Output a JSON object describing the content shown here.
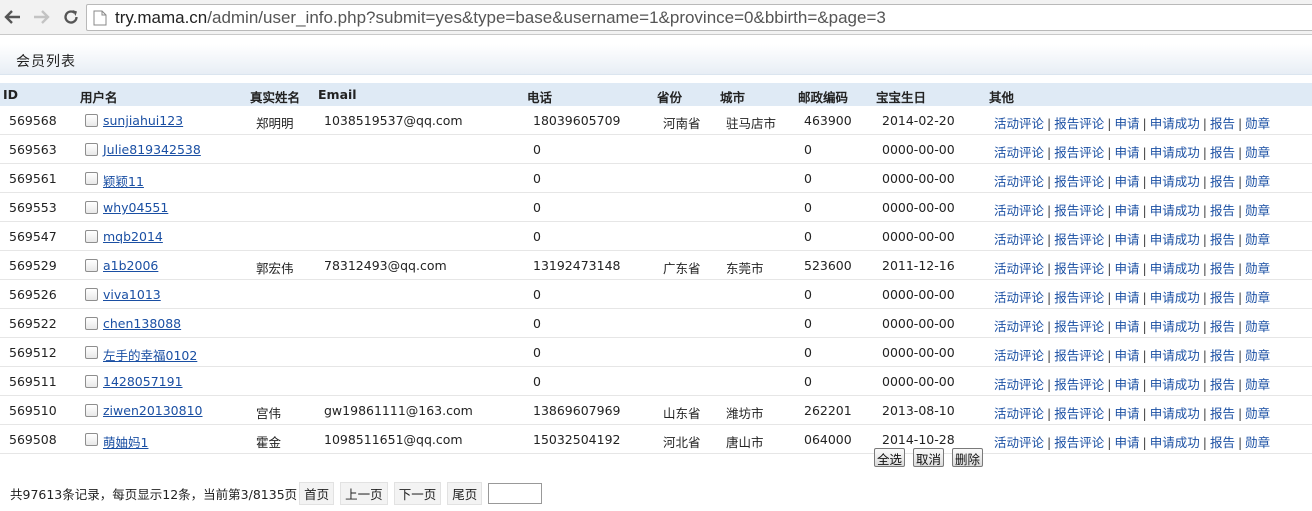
{
  "browser": {
    "url_host": "try.mama.cn",
    "url_path": "/admin/user_info.php?submit=yes&type=base&username=1&province=0&bbirth=&page=3"
  },
  "page": {
    "title": "会员列表"
  },
  "table": {
    "headers": [
      "ID",
      "用户名",
      "真实姓名",
      "Email",
      "电话",
      "省份",
      "城市",
      "邮政编码",
      "宝宝生日",
      "其他"
    ],
    "row_actions": [
      "活动评论",
      "报告评论",
      "申请",
      "申请成功",
      "报告",
      "勋章"
    ],
    "rows": [
      {
        "id": "569568",
        "username": "sunjiahui123",
        "realname": "郑明明",
        "email": "1038519537@qq.com",
        "phone": "18039605709",
        "province": "河南省",
        "city": "驻马店市",
        "zip": "463900",
        "birth": "2014-02-20"
      },
      {
        "id": "569563",
        "username": "Julie819342538",
        "realname": "",
        "email": "",
        "phone": "0",
        "province": "",
        "city": "",
        "zip": "0",
        "birth": "0000-00-00"
      },
      {
        "id": "569561",
        "username": "颖颖11",
        "realname": "",
        "email": "",
        "phone": "0",
        "province": "",
        "city": "",
        "zip": "0",
        "birth": "0000-00-00"
      },
      {
        "id": "569553",
        "username": "why04551",
        "realname": "",
        "email": "",
        "phone": "0",
        "province": "",
        "city": "",
        "zip": "0",
        "birth": "0000-00-00"
      },
      {
        "id": "569547",
        "username": "mqb2014",
        "realname": "",
        "email": "",
        "phone": "0",
        "province": "",
        "city": "",
        "zip": "0",
        "birth": "0000-00-00"
      },
      {
        "id": "569529",
        "username": "a1b2006",
        "realname": "郭宏伟",
        "email": "78312493@qq.com",
        "phone": "13192473148",
        "province": "广东省",
        "city": "东莞市",
        "zip": "523600",
        "birth": "2011-12-16"
      },
      {
        "id": "569526",
        "username": "viva1013",
        "realname": "",
        "email": "",
        "phone": "0",
        "province": "",
        "city": "",
        "zip": "0",
        "birth": "0000-00-00"
      },
      {
        "id": "569522",
        "username": "chen138088",
        "realname": "",
        "email": "",
        "phone": "0",
        "province": "",
        "city": "",
        "zip": "0",
        "birth": "0000-00-00"
      },
      {
        "id": "569512",
        "username": "左手的幸福0102",
        "realname": "",
        "email": "",
        "phone": "0",
        "province": "",
        "city": "",
        "zip": "0",
        "birth": "0000-00-00"
      },
      {
        "id": "569511",
        "username": "1428057191",
        "realname": "",
        "email": "",
        "phone": "0",
        "province": "",
        "city": "",
        "zip": "0",
        "birth": "0000-00-00"
      },
      {
        "id": "569510",
        "username": "ziwen20130810",
        "realname": "宫伟",
        "email": "gw19861111@163.com",
        "phone": "13869607969",
        "province": "山东省",
        "city": "潍坊市",
        "zip": "262201",
        "birth": "2013-08-10"
      },
      {
        "id": "569508",
        "username": "萌妯妈1",
        "realname": "霍金",
        "email": "1098511651@qq.com",
        "phone": "15032504192",
        "province": "河北省",
        "city": "唐山市",
        "zip": "064000",
        "birth": "2014-10-28"
      }
    ]
  },
  "actions": {
    "select_all": "全选",
    "cancel": "取消",
    "delete": "删除"
  },
  "pager": {
    "summary": "共97613条记录，每页显示12条，当前第3/8135页",
    "first": "首页",
    "prev": "上一页",
    "next": "下一页",
    "last": "尾页",
    "jump_value": ""
  }
}
